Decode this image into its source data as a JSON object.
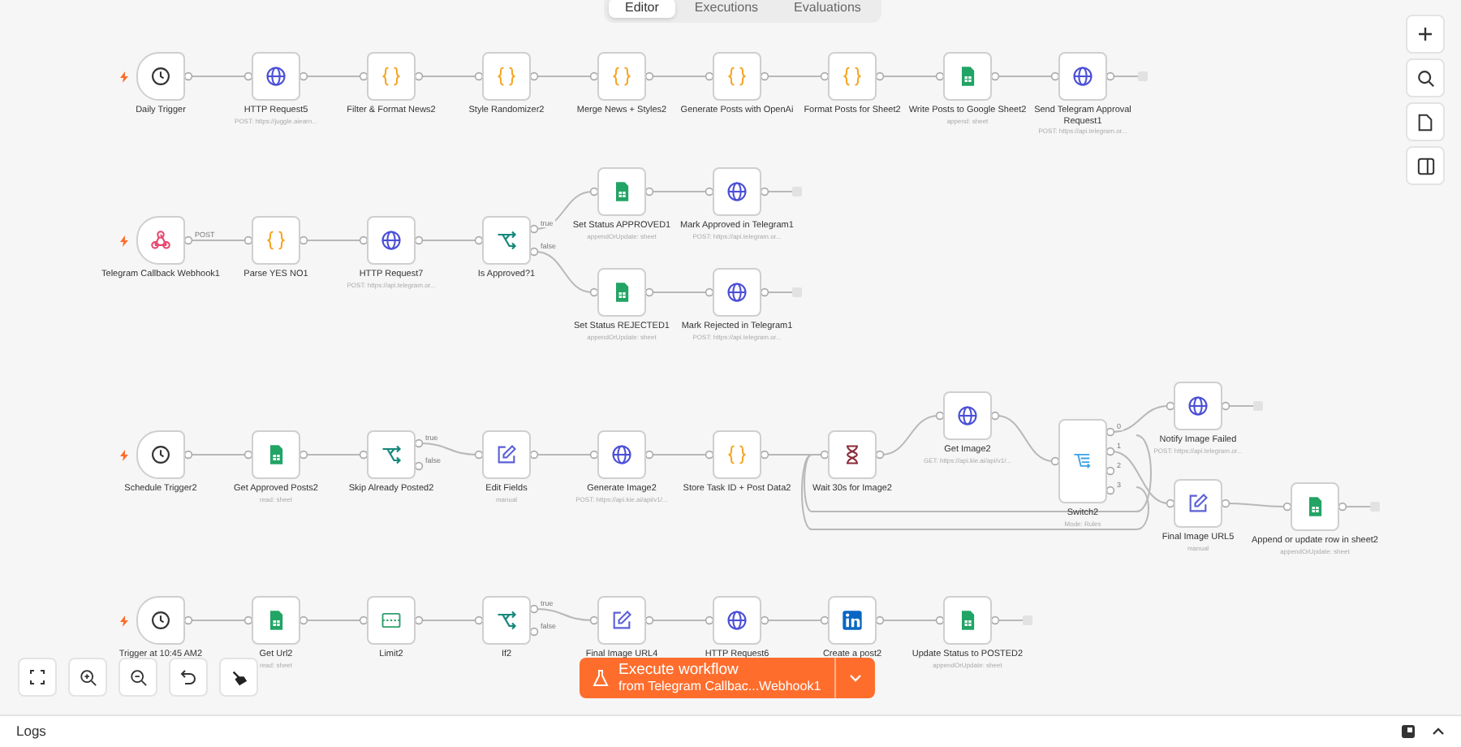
{
  "tabs": [
    {
      "label": "Editor",
      "selected": true
    },
    {
      "label": "Executions",
      "selected": false
    },
    {
      "label": "Evaluations",
      "selected": false
    }
  ],
  "rows": [
    {
      "nodes": [
        {
          "label": "Daily Trigger",
          "kind": "clock",
          "trigger": true
        },
        {
          "label": "HTTP Request5",
          "subtitle": "POST: https://juggle.aiearn...",
          "kind": "globe",
          "trigger": false
        },
        {
          "label": "Filter & Format News2",
          "kind": "code",
          "trigger": false
        },
        {
          "label": "Style Randomizer2",
          "kind": "code",
          "trigger": false
        },
        {
          "label": "Merge News + Styles2",
          "kind": "code",
          "trigger": false
        },
        {
          "label": "Generate Posts with OpenAi",
          "kind": "code",
          "trigger": false
        },
        {
          "label": "Format Posts for Sheet2",
          "kind": "code",
          "trigger": false
        },
        {
          "label": "Write Posts to Google Sheet2",
          "subtitle": "append: sheet",
          "kind": "sheets",
          "trigger": false
        },
        {
          "label": "Send Telegram Approval Request1",
          "subtitle": "POST: https://api.telegram.or...",
          "kind": "globe",
          "trigger": false
        }
      ]
    },
    {
      "nodes": [
        {
          "label": "Telegram Callback Webhook1",
          "kind": "webhook",
          "trigger": true,
          "outputs": [
            "POST"
          ]
        },
        {
          "label": "Parse YES NO1",
          "kind": "code",
          "trigger": false
        },
        {
          "label": "HTTP Request7",
          "subtitle": "POST: https://api.telegram.or...",
          "kind": "globe",
          "trigger": false
        },
        {
          "label": "Is Approved?1",
          "kind": "branch",
          "trigger": false,
          "outputs": [
            "true",
            "false"
          ]
        },
        {
          "label": "Set Status APPROVED1",
          "subtitle": "appendOrUpdate: sheet",
          "kind": "sheets",
          "trigger": false
        },
        {
          "label": "Mark Approved in Telegram1",
          "subtitle": "POST: https://api.telegram.or...",
          "kind": "globe",
          "trigger": false
        },
        {
          "label": "Set Status REJECTED1",
          "subtitle": "appendOrUpdate: sheet",
          "kind": "sheets",
          "trigger": false
        },
        {
          "label": "Mark Rejected in Telegram1",
          "subtitle": "POST: https://api.telegram.or...",
          "kind": "globe",
          "trigger": false
        }
      ]
    },
    {
      "nodes": [
        {
          "label": "Schedule Trigger2",
          "kind": "clock",
          "trigger": true
        },
        {
          "label": "Get Approved Posts2",
          "subtitle": "read: sheet",
          "kind": "sheets",
          "trigger": false
        },
        {
          "label": "Skip Already Posted2",
          "kind": "branch",
          "trigger": false,
          "outputs": [
            "true",
            "false"
          ]
        },
        {
          "label": "Edit Fields",
          "subtitle": "manual",
          "kind": "pencil",
          "trigger": false
        },
        {
          "label": "Generate Image2",
          "subtitle": "POST: https://api.kie.ai/api/v1/...",
          "kind": "globe",
          "trigger": false
        },
        {
          "label": "Store Task ID + Post Data2",
          "kind": "code",
          "trigger": false
        },
        {
          "label": "Wait 30s for Image2",
          "kind": "hourglass",
          "trigger": false
        },
        {
          "label": "Get Image2",
          "subtitle": "GET: https://api.kie.ai/api/v1/...",
          "kind": "globe",
          "trigger": false
        },
        {
          "label": "Switch2",
          "subtitle": "Mode: Rules",
          "kind": "switch",
          "trigger": false,
          "outputs": [
            "0",
            "1",
            "2",
            "3"
          ]
        },
        {
          "label": "Notify Image Failed",
          "subtitle": "POST: https://api.telegram.or...",
          "kind": "globe",
          "trigger": false
        },
        {
          "label": "Final Image URL5",
          "subtitle": "manual",
          "kind": "pencil",
          "trigger": false
        },
        {
          "label": "Append or update row in sheet2",
          "subtitle": "appendOrUpdate: sheet",
          "kind": "sheets",
          "trigger": false
        }
      ]
    },
    {
      "nodes": [
        {
          "label": "Trigger at 10:45 AM2",
          "kind": "clock",
          "trigger": true
        },
        {
          "label": "Get Url2",
          "subtitle": "read: sheet",
          "kind": "sheets",
          "trigger": false
        },
        {
          "label": "Limit2",
          "kind": "limit",
          "trigger": false
        },
        {
          "label": "If2",
          "kind": "branch",
          "trigger": false,
          "outputs": [
            "true",
            "false"
          ]
        },
        {
          "label": "Final Image URL4",
          "kind": "pencil",
          "trigger": false
        },
        {
          "label": "HTTP Request6",
          "kind": "globe",
          "trigger": false
        },
        {
          "label": "Create a post2",
          "kind": "linkedin",
          "trigger": false
        },
        {
          "label": "Update Status to POSTED2",
          "subtitle": "appendOrUpdate: sheet",
          "kind": "sheets",
          "trigger": false
        }
      ]
    }
  ],
  "execute_button": {
    "label": "Execute workflow",
    "source": "from Telegram Callbac...Webhook1"
  },
  "logs": {
    "label": "Logs"
  }
}
